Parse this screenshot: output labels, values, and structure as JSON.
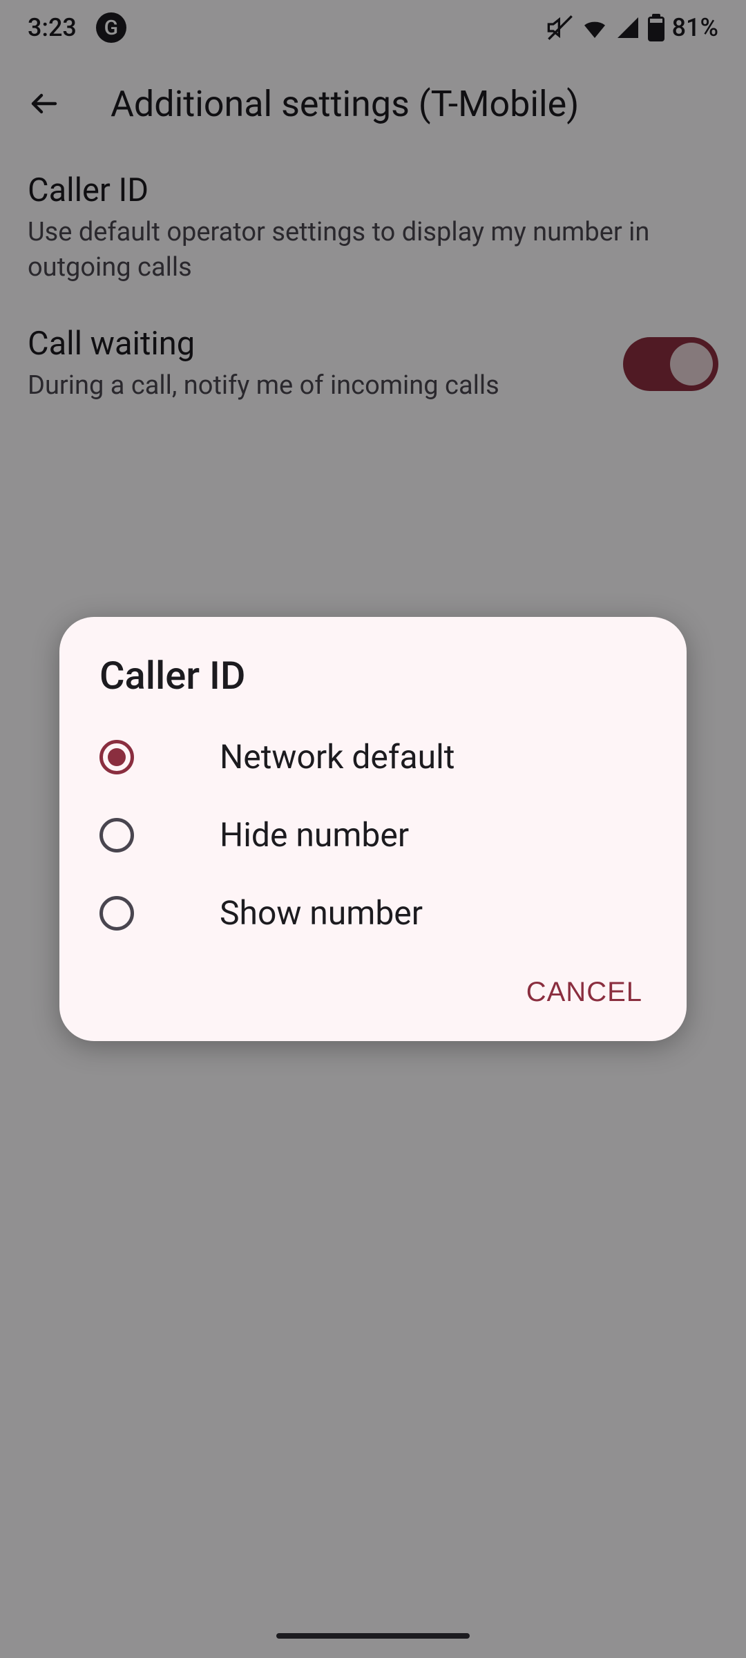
{
  "statusBar": {
    "time": "3:23",
    "battery": "81%"
  },
  "header": {
    "title": "Additional settings (T-Mobile)"
  },
  "settings": {
    "callerId": {
      "title": "Caller ID",
      "desc": "Use default operator settings to display my number in outgoing calls"
    },
    "callWaiting": {
      "title": "Call waiting",
      "desc": "During a call, notify me of incoming calls",
      "enabled": true
    }
  },
  "dialog": {
    "title": "Caller ID",
    "options": [
      {
        "label": "Network default",
        "selected": true
      },
      {
        "label": "Hide number",
        "selected": false
      },
      {
        "label": "Show number",
        "selected": false
      }
    ],
    "cancel": "CANCEL"
  }
}
